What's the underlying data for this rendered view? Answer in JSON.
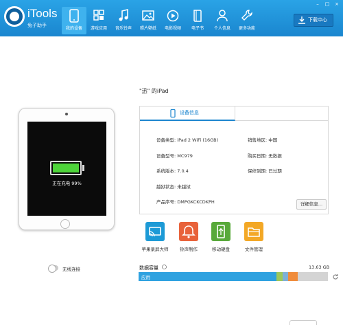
{
  "app": {
    "logo_text": "iTools",
    "logo_sub": "兔子助手"
  },
  "nav": [
    {
      "label": "我的设备",
      "icon": "tablet-icon",
      "active": true
    },
    {
      "label": "游戏应用",
      "icon": "apps-icon",
      "active": false
    },
    {
      "label": "音乐铃声",
      "icon": "music-icon",
      "active": false
    },
    {
      "label": "照片壁纸",
      "icon": "photo-icon",
      "active": false
    },
    {
      "label": "电影视频",
      "icon": "play-icon",
      "active": false
    },
    {
      "label": "电子书",
      "icon": "book-icon",
      "active": false
    },
    {
      "label": "个人信息",
      "icon": "person-icon",
      "active": false
    },
    {
      "label": "更多功能",
      "icon": "wrench-icon",
      "active": false
    }
  ],
  "window_controls": {
    "minimize": "–",
    "restore": "□",
    "close": "×"
  },
  "download_center": "下载中心",
  "device": {
    "name": "\"迅\" 的iPad",
    "charge_text": "正在充电 99%",
    "battery_level": 0.99
  },
  "info": {
    "tab_label": "设备信息",
    "left": [
      {
        "label": "设备类型:",
        "value": "iPad 2 WiFi   (16GB)"
      },
      {
        "label": "设备型号:",
        "value": "MC979"
      },
      {
        "label": "系统版本:",
        "value": "7.0.4"
      },
      {
        "label": "越狱状态:",
        "value": "未越狱"
      },
      {
        "label": "产品序号:",
        "value": "DMPGKCKCDKPH"
      }
    ],
    "right": [
      {
        "label": "销售地区:",
        "value": "中国"
      },
      {
        "label": "购买日期:",
        "value": "无数据"
      },
      {
        "label": "保修到期:",
        "value": "已过期"
      }
    ],
    "detail_button": "详细信息..."
  },
  "quick_actions": [
    {
      "label": "苹果录屏大师",
      "icon": "screen-cast-icon",
      "color": "#1d9ad6"
    },
    {
      "label": "铃声制作",
      "icon": "bell-icon",
      "color": "#e8623a"
    },
    {
      "label": "移动硬盘",
      "icon": "usb-drive-icon",
      "color": "#58a93a"
    },
    {
      "label": "文件管理",
      "icon": "folder-icon",
      "color": "#f3a826"
    }
  ],
  "wireless": {
    "label": "无线连接",
    "enabled": false
  },
  "storage": {
    "title": "数据容量",
    "total": "13.63 GB",
    "segments": [
      {
        "label": "应用",
        "fraction": 0.73,
        "color": "#2fa2e0"
      },
      {
        "label": "",
        "fraction": 0.03,
        "color": "#9ec85a"
      },
      {
        "label": "",
        "fraction": 0.03,
        "color": "#7fb0d8"
      },
      {
        "label": "",
        "fraction": 0.05,
        "color": "#f08c3c"
      }
    ],
    "free_color": "#d4d4d4"
  }
}
